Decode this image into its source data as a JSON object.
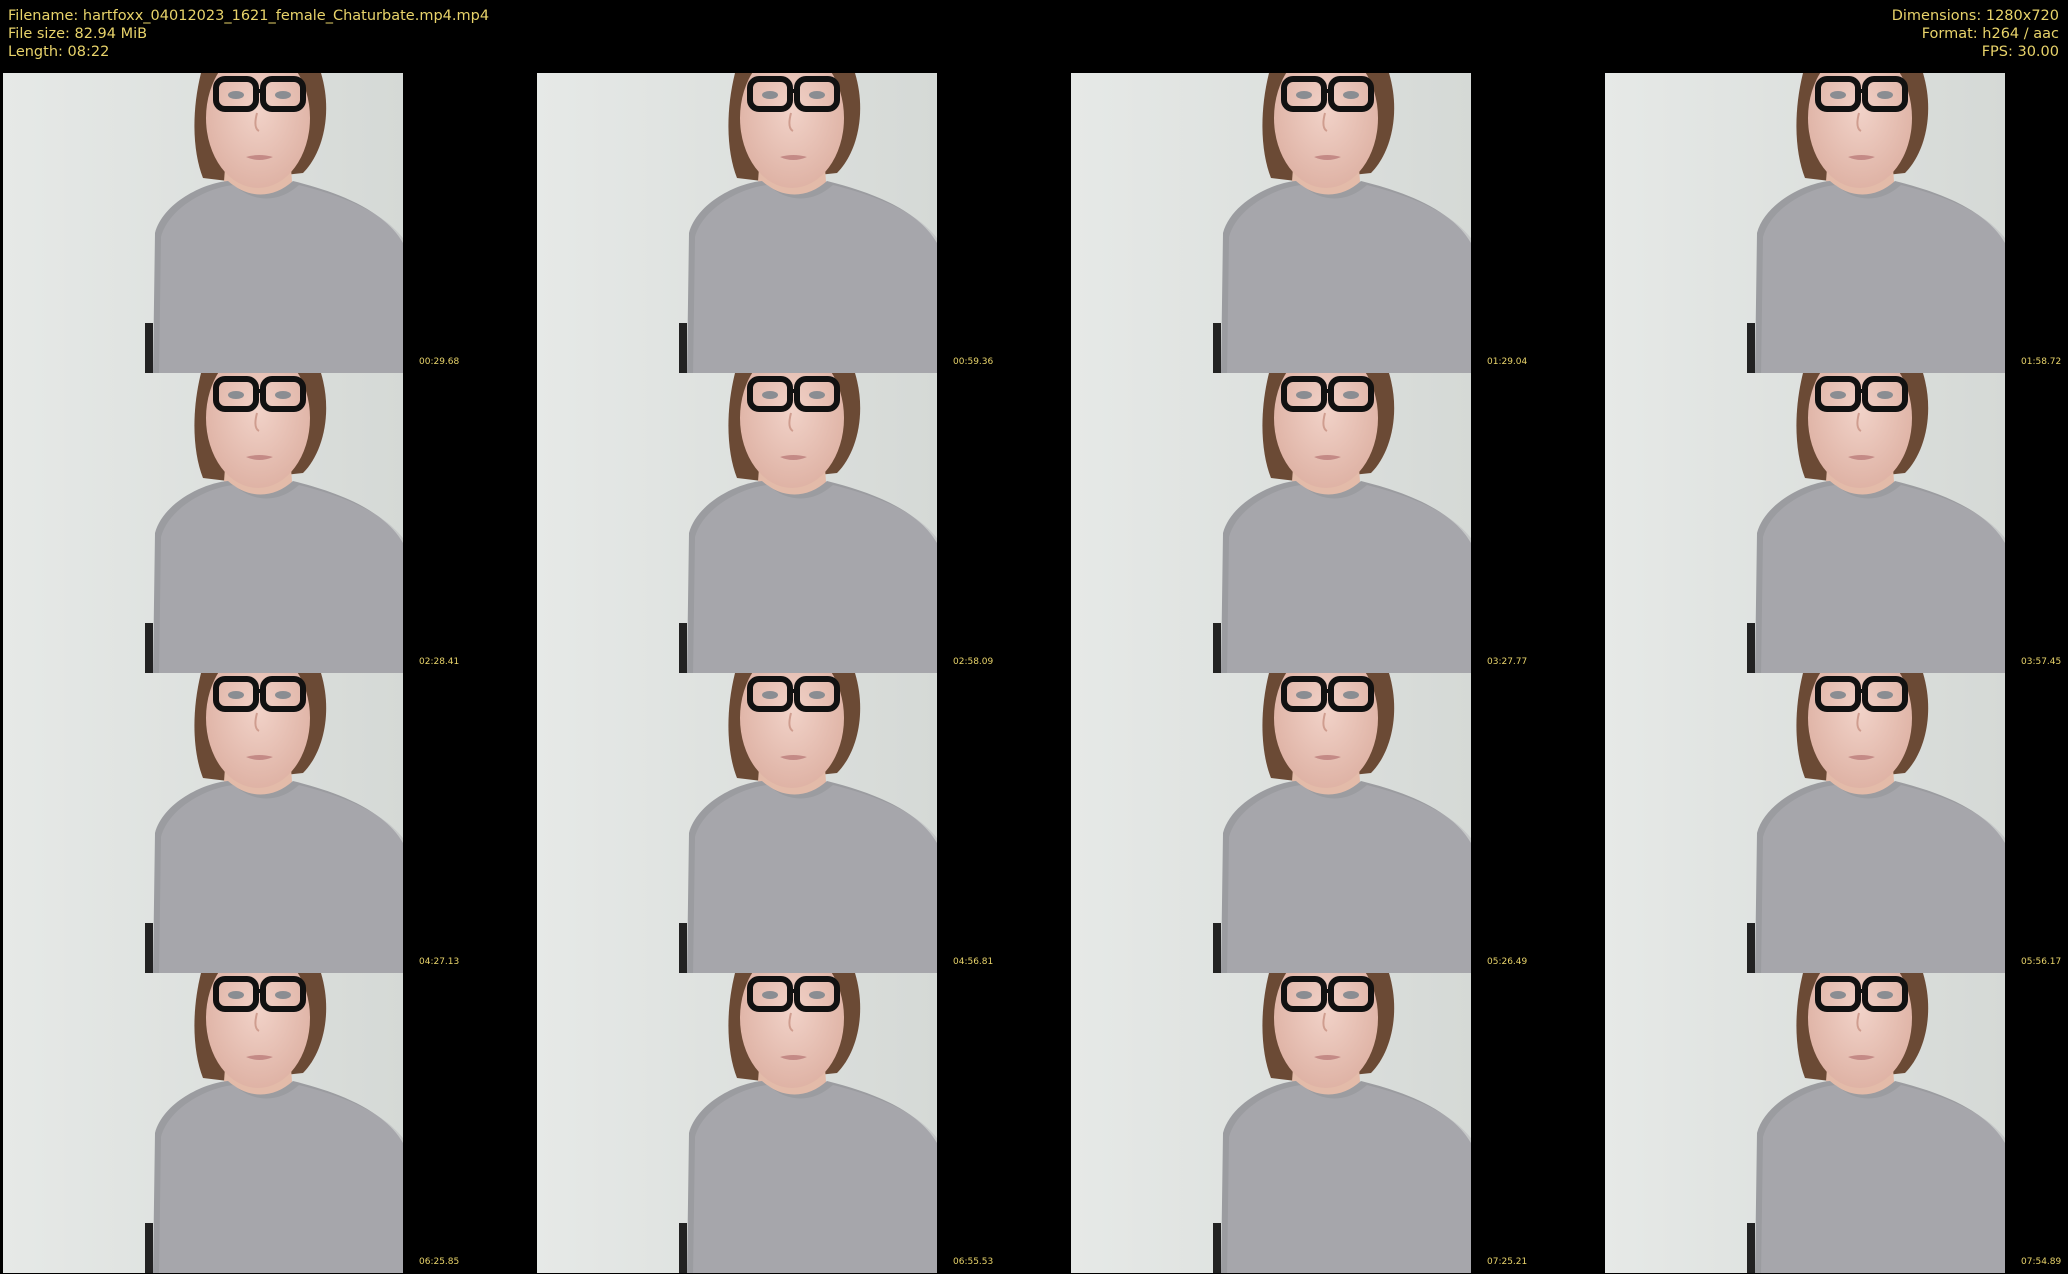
{
  "info": {
    "filename": "Filename: hartfoxx_04012023_1621_female_Chaturbate.mp4.mp4",
    "filesize": "File size: 82.94 MiB",
    "length": "Length: 08:22",
    "dimensions": "Dimensions: 1280x720",
    "format": "Format: h264 / aac",
    "fps": "FPS: 30.00"
  },
  "colors": {
    "text": "#e8d36a",
    "background": "#000000"
  },
  "thumbnails": [
    {
      "timestamp": "00:29.68"
    },
    {
      "timestamp": "00:59.36"
    },
    {
      "timestamp": "01:29.04"
    },
    {
      "timestamp": "01:58.72"
    },
    {
      "timestamp": "02:28.41"
    },
    {
      "timestamp": "02:58.09"
    },
    {
      "timestamp": "03:27.77"
    },
    {
      "timestamp": "03:57.45"
    },
    {
      "timestamp": "04:27.13"
    },
    {
      "timestamp": "04:56.81"
    },
    {
      "timestamp": "05:26.49"
    },
    {
      "timestamp": "05:56.17"
    },
    {
      "timestamp": "06:25.85"
    },
    {
      "timestamp": "06:55.53"
    },
    {
      "timestamp": "07:25.21"
    },
    {
      "timestamp": "07:54.89"
    }
  ]
}
